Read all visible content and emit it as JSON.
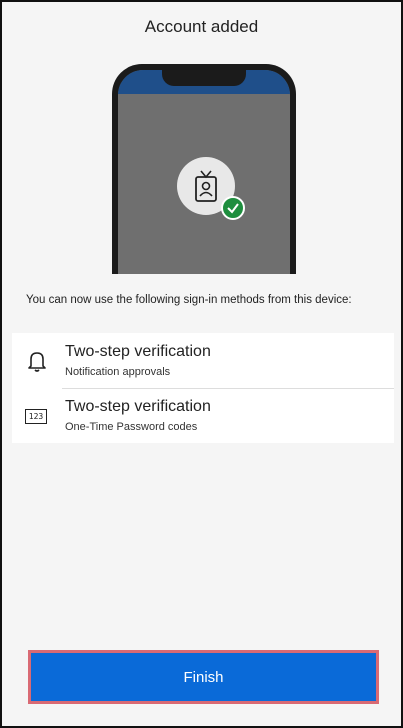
{
  "header": {
    "title": "Account added"
  },
  "illustration": {
    "status_bar_color": "#1f4f8a",
    "icon": "id-badge-icon",
    "check_icon": "check-icon",
    "check_color": "#1e8e3e"
  },
  "description": "You can now use the following sign-in methods from this device:",
  "methods": [
    {
      "icon": "bell-icon",
      "title": "Two-step verification",
      "subtitle": "Notification approvals"
    },
    {
      "icon": "code-123-icon",
      "icon_text": "123",
      "title": "Two-step verification",
      "subtitle": "One-Time Password codes"
    }
  ],
  "footer": {
    "finish_label": "Finish",
    "button_color": "#0a6ad8",
    "highlight_color": "#d96a74"
  }
}
